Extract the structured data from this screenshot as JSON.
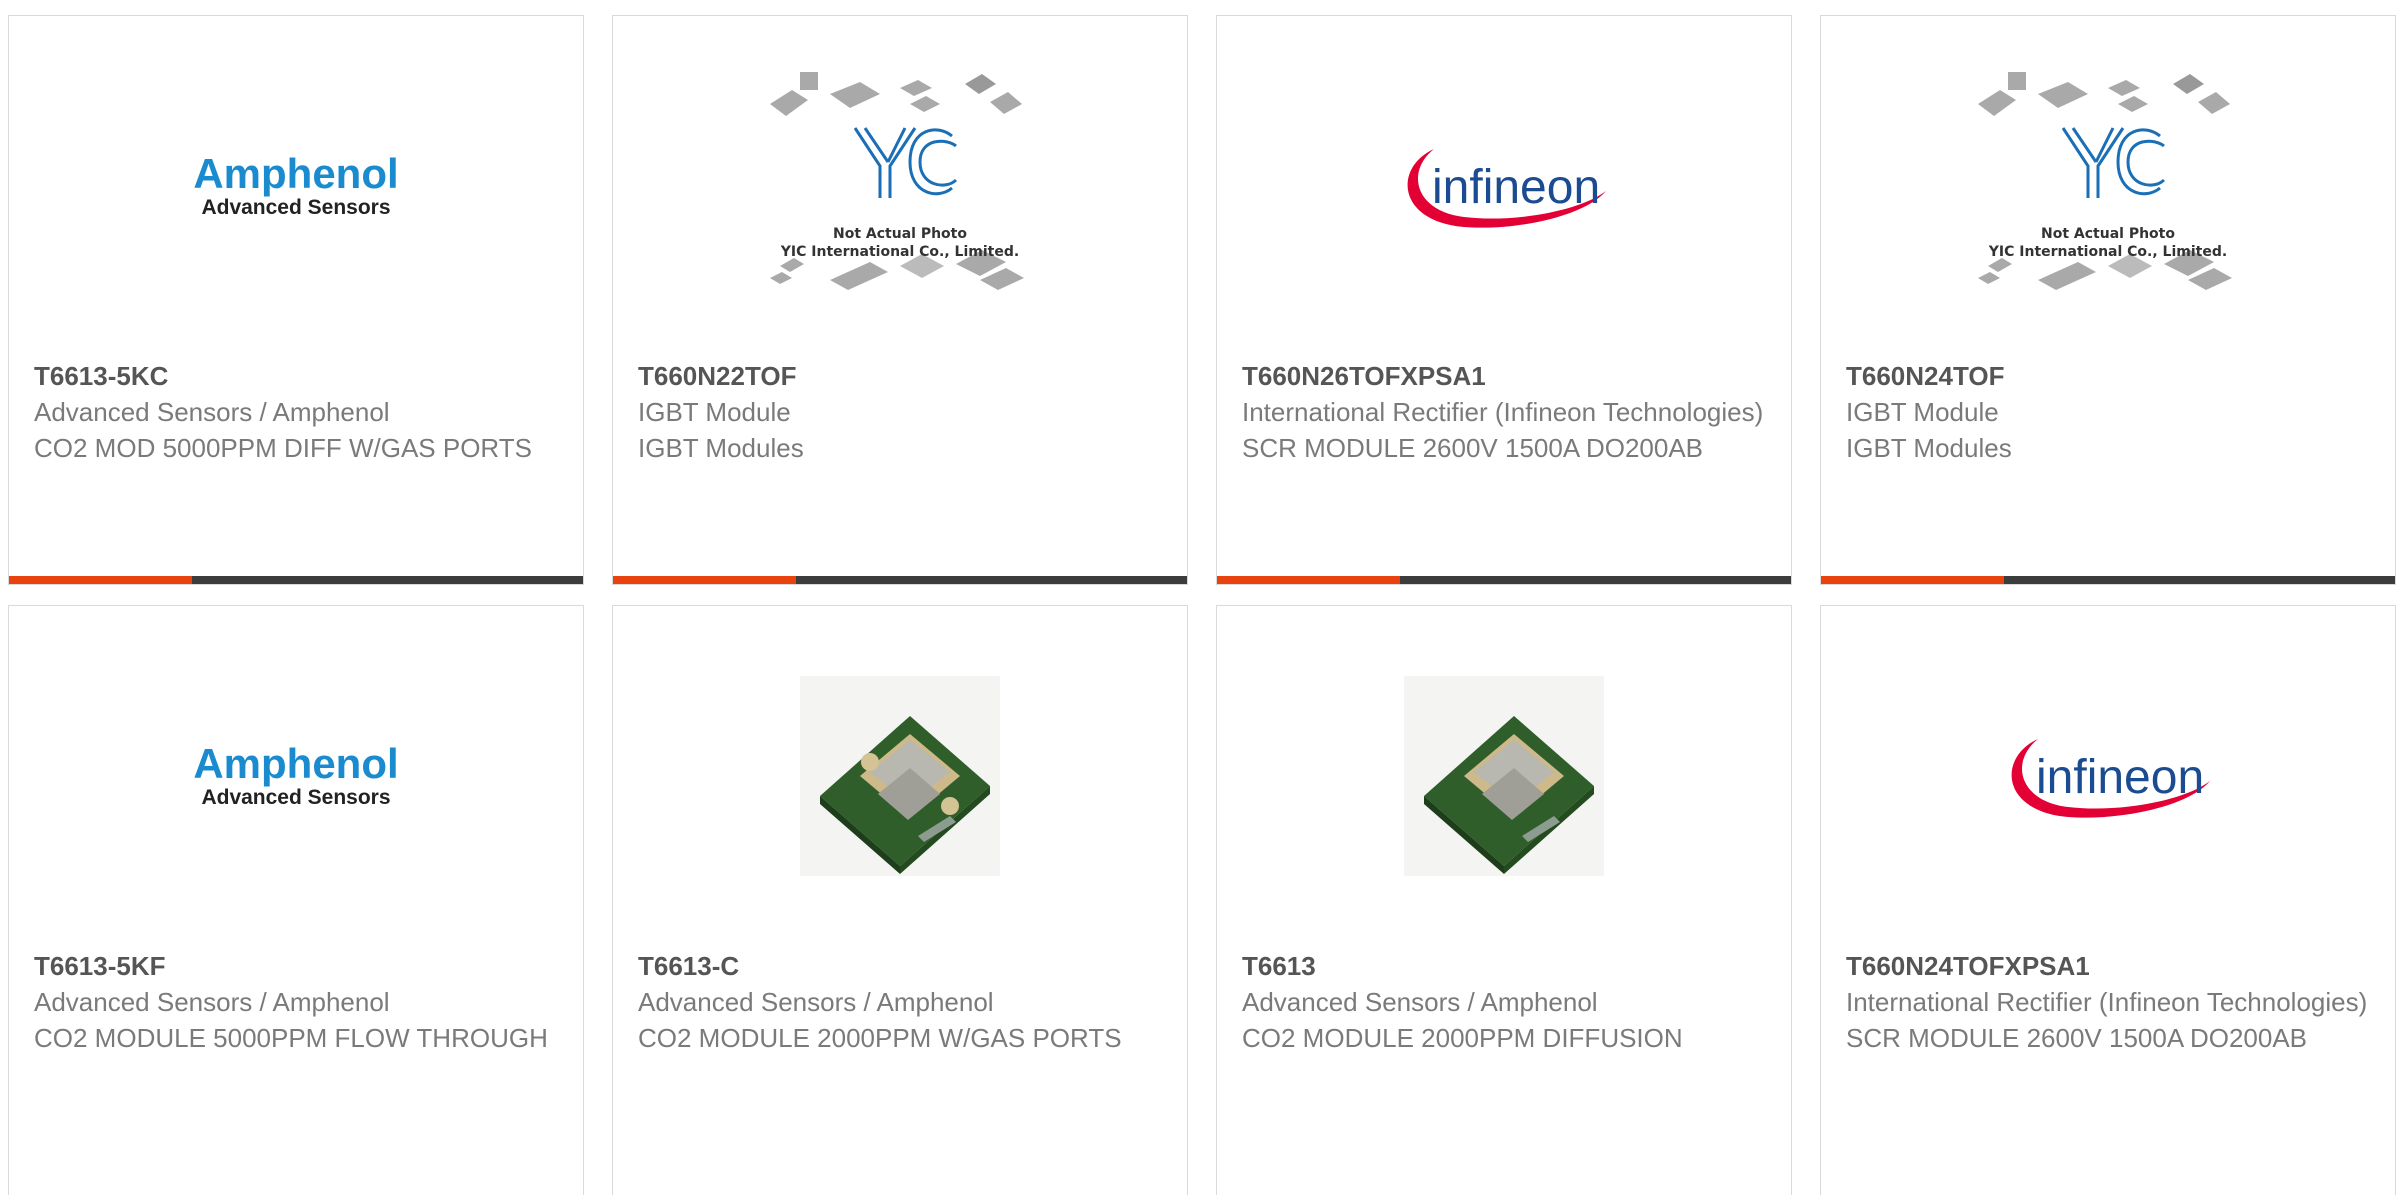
{
  "products": [
    {
      "part_number": "T6613-5KC",
      "manufacturer": "Advanced Sensors / Amphenol",
      "description": "CO2 MOD 5000PPM DIFF W/GAS PORTS",
      "image": "amphenol-logo",
      "logo_text": [
        "Amphenol",
        "Advanced Sensors"
      ]
    },
    {
      "part_number": "T660N22TOF",
      "manufacturer": "IGBT Module",
      "description": "IGBT Modules",
      "image": "yic-placeholder",
      "logo_text": [
        "Not Actual Photo",
        "YIC International Co., Limited."
      ]
    },
    {
      "part_number": "T660N26TOFXPSA1",
      "manufacturer": "International Rectifier (Infineon Technologies)",
      "description": "SCR MODULE 2600V 1500A DO200AB",
      "image": "infineon-logo",
      "logo_text": [
        "infineon"
      ]
    },
    {
      "part_number": "T660N24TOF",
      "manufacturer": "IGBT Module",
      "description": "IGBT Modules",
      "image": "yic-placeholder",
      "logo_text": [
        "Not Actual Photo",
        "YIC International Co., Limited."
      ]
    },
    {
      "part_number": "T6613-5KF",
      "manufacturer": "Advanced Sensors / Amphenol",
      "description": "CO2 MODULE 5000PPM FLOW THROUGH",
      "image": "amphenol-logo",
      "logo_text": [
        "Amphenol",
        "Advanced Sensors"
      ]
    },
    {
      "part_number": "T6613-C",
      "manufacturer": "Advanced Sensors / Amphenol",
      "description": "CO2 MODULE 2000PPM W/GAS PORTS",
      "image": "sensor-module-photo"
    },
    {
      "part_number": "T6613",
      "manufacturer": "Advanced Sensors / Amphenol",
      "description": "CO2 MODULE 2000PPM DIFFUSION",
      "image": "sensor-module-photo"
    },
    {
      "part_number": "T660N24TOFXPSA1",
      "manufacturer": "International Rectifier (Infineon Technologies)",
      "description": "SCR MODULE 2600V 1500A DO200AB",
      "image": "infineon-logo",
      "logo_text": [
        "infineon"
      ]
    }
  ],
  "colors": {
    "accent": "#e8420e",
    "bar": "#3c3c3c",
    "amphenol_blue": "#1a8bcf",
    "infineon_red": "#e30034",
    "infineon_blue": "#1b4b91"
  }
}
